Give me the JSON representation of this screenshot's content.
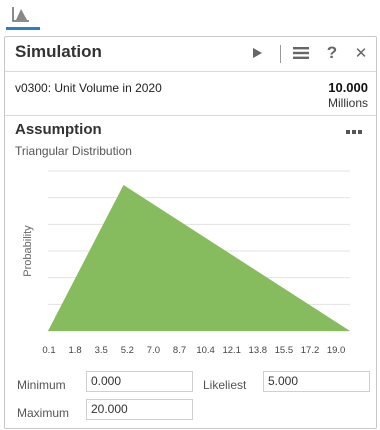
{
  "colors": {
    "accent": "#2d7ec4",
    "fill": "#86bb5e",
    "grid": "#e3e3e3"
  },
  "panel": {
    "title": "Simulation",
    "icons": [
      "play-icon",
      "menu-icon",
      "help-icon",
      "close-icon"
    ],
    "help_glyph": "?",
    "close_glyph": "✕"
  },
  "variable": {
    "name": "v0300: Unit Volume in 2020",
    "value": "10.000",
    "unit": "Millions"
  },
  "assumption": {
    "title": "Assumption",
    "distribution": "Triangular Distribution"
  },
  "chart_data": {
    "type": "area",
    "ylabel": "Probability",
    "x_ticks": [
      "0.1",
      "1.8",
      "3.5",
      "5.2",
      "7.0",
      "8.7",
      "10.4",
      "12.1",
      "13.8",
      "15.5",
      "17.2",
      "19.0"
    ],
    "xlim": [
      0,
      20
    ],
    "grid": true,
    "min": 0,
    "likeliest": 5,
    "max": 20
  },
  "fields": {
    "minimum_label": "Minimum",
    "minimum_value": "0.000",
    "likeliest_label": "Likeliest",
    "likeliest_value": "5.000",
    "maximum_label": "Maximum",
    "maximum_value": "20.000"
  }
}
